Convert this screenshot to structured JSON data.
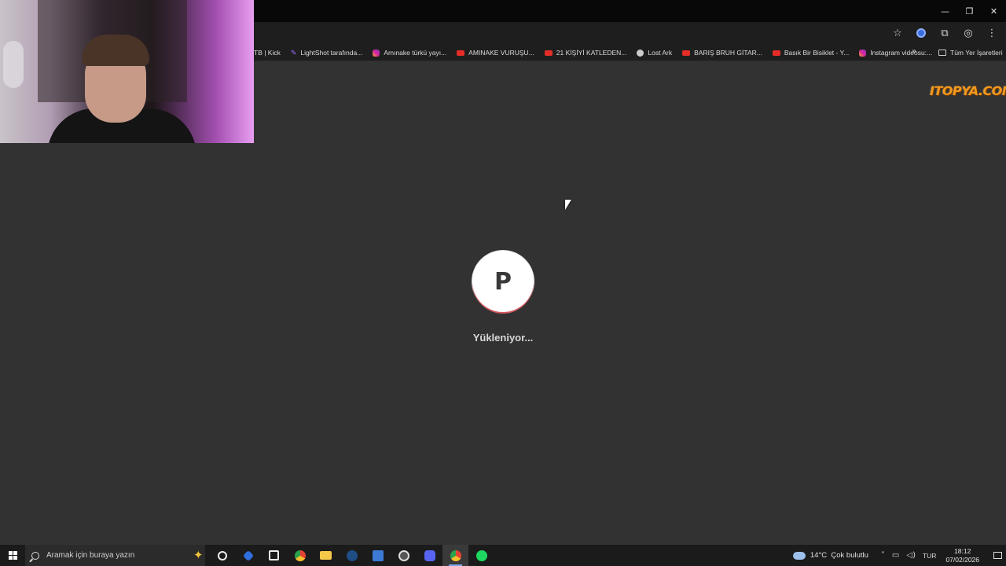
{
  "window": {
    "controls": {
      "minimize": "—",
      "restore": "❐",
      "close": "✕"
    }
  },
  "toolbar": {
    "icons": [
      "star-icon",
      "extension-profile-icon",
      "extensions-icon",
      "browser-wallet-icon",
      "menu-icon"
    ],
    "star": "☆",
    "puzzle": "⧉",
    "shield": "◎",
    "menu": "⋮"
  },
  "bookmarks": {
    "items": [
      {
        "label": "TB | Kick",
        "icon": "none"
      },
      {
        "label": "LightShot tarafında...",
        "icon": "lightshot"
      },
      {
        "label": "Amınake türkü yayı...",
        "icon": "instagram"
      },
      {
        "label": "AMINAKE VURUŞU...",
        "icon": "youtube"
      },
      {
        "label": "21 KİŞİYİ KATLEDEN...",
        "icon": "youtube"
      },
      {
        "label": "Lost Ark",
        "icon": "globe"
      },
      {
        "label": "BARIŞ BRUH GİTAR...",
        "icon": "youtube"
      },
      {
        "label": "Basık Bir Bisiklet - Y...",
        "icon": "youtube"
      },
      {
        "label": "Instagram videosu:...",
        "icon": "instagram"
      }
    ],
    "more": "»",
    "all_bookmarks": "Tüm Yer İşaretleri"
  },
  "watermark": {
    "text": "ITOPYA.COM",
    "color": "#f39a1c"
  },
  "loader": {
    "letter": "P",
    "text": "Yükleniyor...",
    "ring_color": "#d0575e"
  },
  "taskbar": {
    "search_placeholder": "Aramak için buraya yazın",
    "apps": [
      "cortana-icon",
      "pulse-app-icon",
      "store-icon",
      "chrome-icon",
      "file-explorer-icon",
      "steam-icon",
      "blue-app-icon",
      "utility-app-icon",
      "discord-icon",
      "chrome-active-icon",
      "spotify-icon"
    ],
    "weather": {
      "temp": "14°C",
      "condition": "Çok bulutlu"
    },
    "language": "TUR",
    "time": "18:12",
    "date": "07/02/2026"
  }
}
